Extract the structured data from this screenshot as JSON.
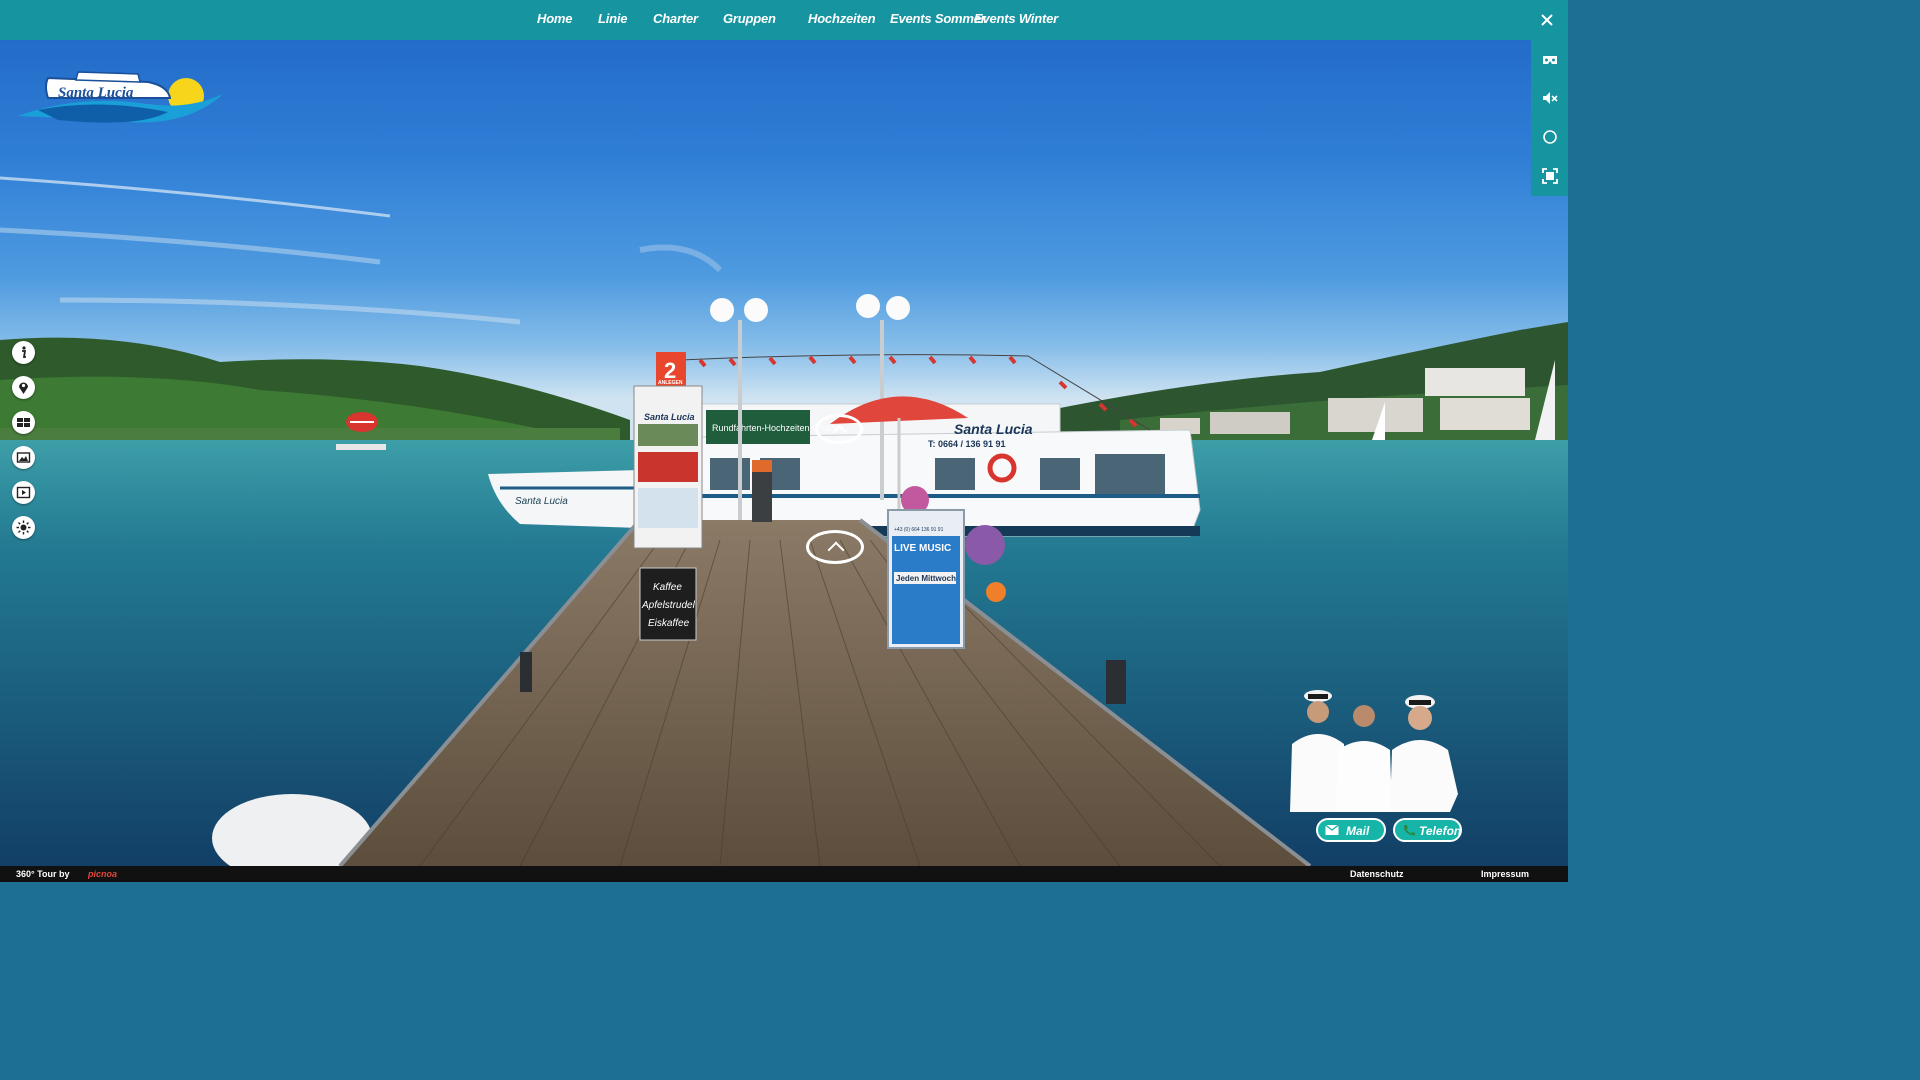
{
  "nav": {
    "items": [
      "Home",
      "Linie",
      "Charter",
      "Gruppen",
      "Hochzeiten",
      "Events Sommer",
      "Events Winter"
    ]
  },
  "logo": {
    "text": "Santa Lucia"
  },
  "scene": {
    "boat_name": "Santa Lucia",
    "boat_phone": "T: 0664 / 136 91 91",
    "boat_banner": "Rundfahrten-Hochzeiten-Charter",
    "pier_number": "2",
    "pier_label": "ANLEGEN",
    "pier_sign_title": "Santa Lucia",
    "chalkboard": [
      "Kaffee",
      "Apfelstrudel",
      "Eiskaffee"
    ],
    "poster_title": "LIVE MUSIC",
    "poster_phone": "+43 (0) 664 136 91 91",
    "poster_day": "Jeden Mittwoch"
  },
  "contact": {
    "mail_label": "Mail",
    "phone_label": "Telefon"
  },
  "footer": {
    "credit": "360° Tour by",
    "brand": "picnoa",
    "privacy": "Datenschutz",
    "imprint": "Impressum"
  },
  "colors": {
    "bar": "#1694a0",
    "button": "#17b5a8",
    "water": "#1f7290",
    "sky": "#2f7ed6"
  }
}
